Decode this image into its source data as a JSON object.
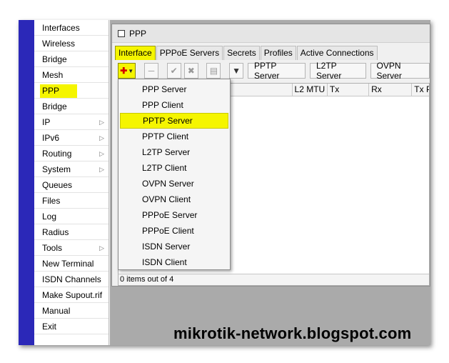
{
  "sidebar": {
    "items": [
      {
        "label": "Interfaces"
      },
      {
        "label": "Wireless"
      },
      {
        "label": "Bridge"
      },
      {
        "label": "Mesh"
      },
      {
        "label": "PPP",
        "highlighted": true
      },
      {
        "label": "Bridge"
      },
      {
        "label": "IP",
        "submenu": true
      },
      {
        "label": "IPv6",
        "submenu": true
      },
      {
        "label": "Routing",
        "submenu": true
      },
      {
        "label": "System",
        "submenu": true
      },
      {
        "label": "Queues"
      },
      {
        "label": "Files"
      },
      {
        "label": "Log"
      },
      {
        "label": "Radius"
      },
      {
        "label": "Tools",
        "submenu": true
      },
      {
        "label": "New Terminal"
      },
      {
        "label": "ISDN Channels"
      },
      {
        "label": "Make Supout.rif"
      },
      {
        "label": "Manual"
      },
      {
        "label": "Exit"
      }
    ]
  },
  "window": {
    "title": "PPP",
    "tabs": [
      {
        "label": "Interface",
        "active": true
      },
      {
        "label": "PPPoE Servers"
      },
      {
        "label": "Secrets"
      },
      {
        "label": "Profiles"
      },
      {
        "label": "Active Connections"
      }
    ],
    "toolbar": {
      "add_icon": "plus-icon",
      "buttons": [
        "PPTP Server",
        "L2TP Server",
        "OVPN Server"
      ]
    },
    "columns": [
      "",
      "L2 MTU",
      "Tx",
      "Rx",
      "Tx P"
    ],
    "status": "0 items out of 4"
  },
  "add_menu": {
    "items": [
      {
        "label": "PPP Server"
      },
      {
        "label": "PPP Client"
      },
      {
        "label": "PPTP Server",
        "highlighted": true
      },
      {
        "label": "PPTP Client"
      },
      {
        "label": "L2TP Server"
      },
      {
        "label": "L2TP Client"
      },
      {
        "label": "OVPN Server"
      },
      {
        "label": "OVPN Client"
      },
      {
        "label": "PPPoE Server"
      },
      {
        "label": "PPPoE Client"
      },
      {
        "label": "ISDN Server"
      },
      {
        "label": "ISDN Client"
      }
    ]
  },
  "watermark": "mikrotik-network.blogspot.com",
  "colors": {
    "highlight": "#f5f500",
    "sidebar_strip": "#2b28b8",
    "add_plus": "#d40000"
  }
}
